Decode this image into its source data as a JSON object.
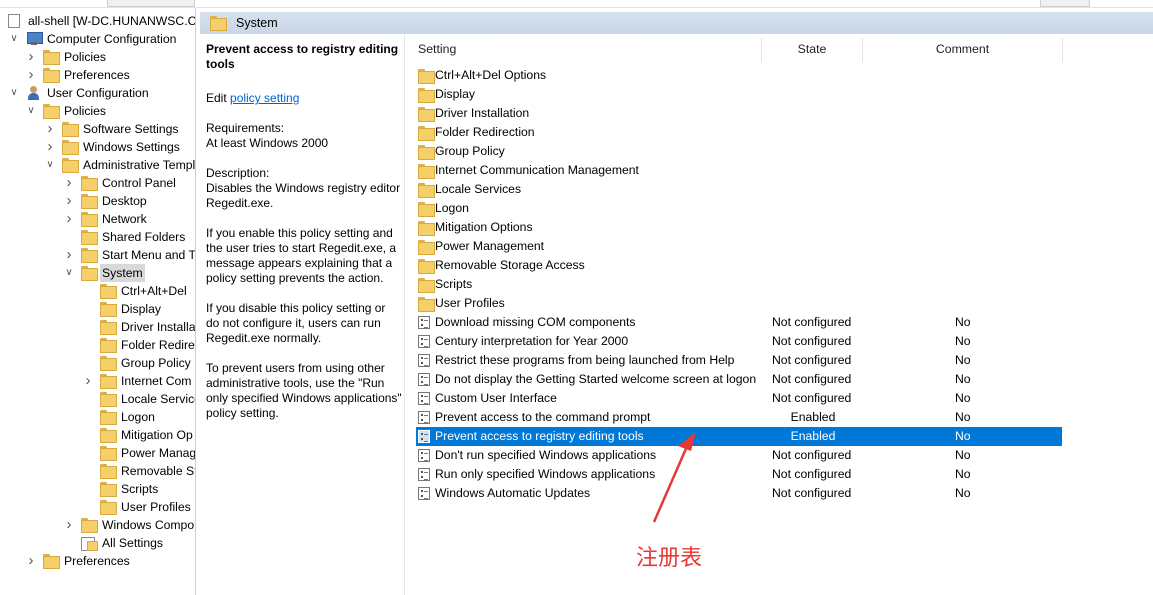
{
  "window": {
    "root_node": "all-shell [W-DC.HUNANWSC.CN"
  },
  "tree": [
    {
      "label": "all-shell [W-DC.HUNANWSC.CN",
      "depth": 0,
      "icon": "document-icon",
      "chev": ""
    },
    {
      "label": "Computer Configuration",
      "depth": 0,
      "icon": "computer-icon",
      "chev": "down"
    },
    {
      "label": "Policies",
      "depth": 1,
      "icon": "folder-icon",
      "chev": "right"
    },
    {
      "label": "Preferences",
      "depth": 1,
      "icon": "folder-icon",
      "chev": "right"
    },
    {
      "label": "User Configuration",
      "depth": 0,
      "icon": "user-icon",
      "chev": "down"
    },
    {
      "label": "Policies",
      "depth": 1,
      "icon": "folder-icon",
      "chev": "down"
    },
    {
      "label": "Software Settings",
      "depth": 2,
      "icon": "folder-icon",
      "chev": "right"
    },
    {
      "label": "Windows Settings",
      "depth": 2,
      "icon": "folder-icon",
      "chev": "right"
    },
    {
      "label": "Administrative Templ",
      "depth": 2,
      "icon": "folder-icon",
      "chev": "down"
    },
    {
      "label": "Control Panel",
      "depth": 3,
      "icon": "folder-icon",
      "chev": "right"
    },
    {
      "label": "Desktop",
      "depth": 3,
      "icon": "folder-icon",
      "chev": "right"
    },
    {
      "label": "Network",
      "depth": 3,
      "icon": "folder-icon",
      "chev": "right"
    },
    {
      "label": "Shared Folders",
      "depth": 3,
      "icon": "folder-icon",
      "chev": ""
    },
    {
      "label": "Start Menu and T",
      "depth": 3,
      "icon": "folder-icon",
      "chev": "right"
    },
    {
      "label": "System",
      "depth": 3,
      "icon": "folder-icon",
      "chev": "down",
      "selected": true
    },
    {
      "label": "Ctrl+Alt+Del",
      "depth": 4,
      "icon": "folder-icon",
      "chev": ""
    },
    {
      "label": "Display",
      "depth": 4,
      "icon": "folder-icon",
      "chev": ""
    },
    {
      "label": "Driver Installa",
      "depth": 4,
      "icon": "folder-icon",
      "chev": ""
    },
    {
      "label": "Folder Redire",
      "depth": 4,
      "icon": "folder-icon",
      "chev": ""
    },
    {
      "label": "Group Policy",
      "depth": 4,
      "icon": "folder-icon",
      "chev": ""
    },
    {
      "label": "Internet Com",
      "depth": 4,
      "icon": "folder-icon",
      "chev": "right"
    },
    {
      "label": "Locale Service",
      "depth": 4,
      "icon": "folder-icon",
      "chev": ""
    },
    {
      "label": "Logon",
      "depth": 4,
      "icon": "folder-icon",
      "chev": ""
    },
    {
      "label": "Mitigation Op",
      "depth": 4,
      "icon": "folder-icon",
      "chev": ""
    },
    {
      "label": "Power Manag",
      "depth": 4,
      "icon": "folder-icon",
      "chev": ""
    },
    {
      "label": "Removable St",
      "depth": 4,
      "icon": "folder-icon",
      "chev": ""
    },
    {
      "label": "Scripts",
      "depth": 4,
      "icon": "folder-icon",
      "chev": ""
    },
    {
      "label": "User Profiles",
      "depth": 4,
      "icon": "folder-icon",
      "chev": ""
    },
    {
      "label": "Windows Compo",
      "depth": 3,
      "icon": "folder-icon",
      "chev": "right"
    },
    {
      "label": "All Settings",
      "depth": 3,
      "icon": "all-settings-icon",
      "chev": ""
    },
    {
      "label": "Preferences",
      "depth": 1,
      "icon": "folder-icon",
      "chev": "right"
    }
  ],
  "header": {
    "title": "System"
  },
  "description": {
    "title": "Prevent access to registry editing tools",
    "edit_prefix": "Edit ",
    "edit_link": "policy setting ",
    "requirements": "Requirements:\nAt least Windows 2000",
    "description": "Description:\nDisables the Windows registry editor Regedit.exe.",
    "para1": "If you enable this policy setting and the user tries to start Regedit.exe, a message appears explaining that a policy setting prevents the action.",
    "para2": "If you disable this policy setting or do not configure it, users can run Regedit.exe normally.",
    "para3": "To prevent users from using other administrative tools, use the \"Run only specified Windows applications\" policy setting."
  },
  "columns": {
    "setting": "Setting",
    "state": "State",
    "comment": "Comment"
  },
  "folders": [
    "Ctrl+Alt+Del Options",
    "Display",
    "Driver Installation",
    "Folder Redirection",
    "Group Policy",
    "Internet Communication Management",
    "Locale Services",
    "Logon",
    "Mitigation Options",
    "Power Management",
    "Removable Storage Access",
    "Scripts",
    "User Profiles"
  ],
  "policies": [
    {
      "name": "Download missing COM components",
      "state": "Not configured",
      "comment": "No"
    },
    {
      "name": "Century interpretation for Year 2000",
      "state": "Not configured",
      "comment": "No"
    },
    {
      "name": "Restrict these programs from being launched from Help",
      "state": "Not configured",
      "comment": "No"
    },
    {
      "name": "Do not display the Getting Started welcome screen at logon",
      "state": "Not configured",
      "comment": "No"
    },
    {
      "name": "Custom User Interface",
      "state": "Not configured",
      "comment": "No"
    },
    {
      "name": "Prevent access to the command prompt",
      "state": "Enabled",
      "comment": "No"
    },
    {
      "name": "Prevent access to registry editing tools",
      "state": "Enabled",
      "comment": "No",
      "selected": true
    },
    {
      "name": "Don't run specified Windows applications",
      "state": "Not configured",
      "comment": "No"
    },
    {
      "name": "Run only specified Windows applications",
      "state": "Not configured",
      "comment": "No"
    },
    {
      "name": "Windows Automatic Updates",
      "state": "Not configured",
      "comment": "No"
    }
  ],
  "annotation": {
    "text": "注册表",
    "color": "#e53935"
  },
  "colors": {
    "selection": "#0078d7",
    "header_band": "#d1dcec",
    "link": "#0066cc"
  }
}
